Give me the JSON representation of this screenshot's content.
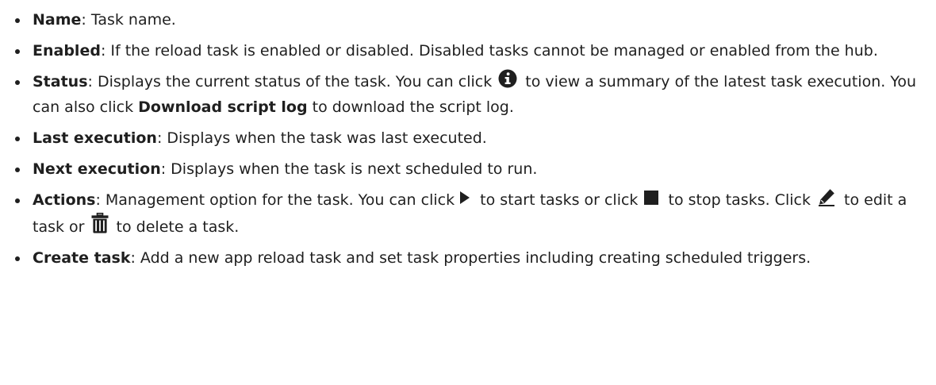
{
  "items": [
    {
      "term": "Name",
      "text": ": Task name."
    },
    {
      "term": "Enabled",
      "text": ": If the reload task is enabled or disabled. Disabled tasks cannot be managed or enabled from the hub."
    },
    {
      "term": "Status",
      "text_before_icon": ": Displays the current status of the task. You can click ",
      "icon": "info-circle-icon",
      "text_after_icon": " to view a summary of the latest task execution. You can also click ",
      "bold_action": "Download script log",
      "text_end": " to download the script log."
    },
    {
      "term": "Last execution",
      "text": ": Displays when the task was last executed."
    },
    {
      "term": "Next execution",
      "text": ": Displays when the task is next scheduled to run."
    },
    {
      "term": "Actions",
      "text_1": ": Management option for the task. You can click ",
      "icon_1": "play-icon",
      "text_2": " to start tasks or click ",
      "icon_2": "stop-icon",
      "text_3": " to stop tasks. Click ",
      "icon_3": "pencil-icon",
      "text_4": " to edit a task or ",
      "icon_4": "trash-icon",
      "text_5": " to delete a task."
    },
    {
      "term": "Create task",
      "text": ": Add a new app reload task and set task properties including creating scheduled triggers."
    }
  ]
}
